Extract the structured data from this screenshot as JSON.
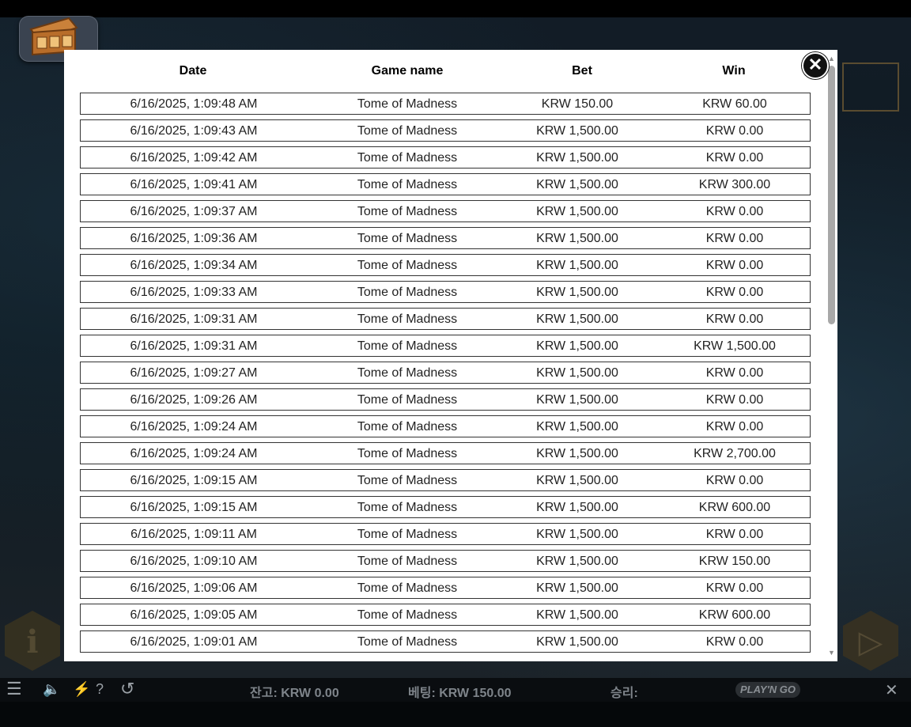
{
  "modal": {
    "headers": {
      "date": "Date",
      "game": "Game name",
      "bet": "Bet",
      "win": "Win"
    },
    "rows": [
      {
        "date": "6/16/2025, 1:09:48 AM",
        "game": "Tome of Madness",
        "bet": "KRW 150.00",
        "win": "KRW 60.00"
      },
      {
        "date": "6/16/2025, 1:09:43 AM",
        "game": "Tome of Madness",
        "bet": "KRW 1,500.00",
        "win": "KRW 0.00"
      },
      {
        "date": "6/16/2025, 1:09:42 AM",
        "game": "Tome of Madness",
        "bet": "KRW 1,500.00",
        "win": "KRW 0.00"
      },
      {
        "date": "6/16/2025, 1:09:41 AM",
        "game": "Tome of Madness",
        "bet": "KRW 1,500.00",
        "win": "KRW 300.00"
      },
      {
        "date": "6/16/2025, 1:09:37 AM",
        "game": "Tome of Madness",
        "bet": "KRW 1,500.00",
        "win": "KRW 0.00"
      },
      {
        "date": "6/16/2025, 1:09:36 AM",
        "game": "Tome of Madness",
        "bet": "KRW 1,500.00",
        "win": "KRW 0.00"
      },
      {
        "date": "6/16/2025, 1:09:34 AM",
        "game": "Tome of Madness",
        "bet": "KRW 1,500.00",
        "win": "KRW 0.00"
      },
      {
        "date": "6/16/2025, 1:09:33 AM",
        "game": "Tome of Madness",
        "bet": "KRW 1,500.00",
        "win": "KRW 0.00"
      },
      {
        "date": "6/16/2025, 1:09:31 AM",
        "game": "Tome of Madness",
        "bet": "KRW 1,500.00",
        "win": "KRW 0.00"
      },
      {
        "date": "6/16/2025, 1:09:31 AM",
        "game": "Tome of Madness",
        "bet": "KRW 1,500.00",
        "win": "KRW 1,500.00"
      },
      {
        "date": "6/16/2025, 1:09:27 AM",
        "game": "Tome of Madness",
        "bet": "KRW 1,500.00",
        "win": "KRW 0.00"
      },
      {
        "date": "6/16/2025, 1:09:26 AM",
        "game": "Tome of Madness",
        "bet": "KRW 1,500.00",
        "win": "KRW 0.00"
      },
      {
        "date": "6/16/2025, 1:09:24 AM",
        "game": "Tome of Madness",
        "bet": "KRW 1,500.00",
        "win": "KRW 0.00"
      },
      {
        "date": "6/16/2025, 1:09:24 AM",
        "game": "Tome of Madness",
        "bet": "KRW 1,500.00",
        "win": "KRW 2,700.00"
      },
      {
        "date": "6/16/2025, 1:09:15 AM",
        "game": "Tome of Madness",
        "bet": "KRW 1,500.00",
        "win": "KRW 0.00"
      },
      {
        "date": "6/16/2025, 1:09:15 AM",
        "game": "Tome of Madness",
        "bet": "KRW 1,500.00",
        "win": "KRW 600.00"
      },
      {
        "date": "6/16/2025, 1:09:11 AM",
        "game": "Tome of Madness",
        "bet": "KRW 1,500.00",
        "win": "KRW 0.00"
      },
      {
        "date": "6/16/2025, 1:09:10 AM",
        "game": "Tome of Madness",
        "bet": "KRW 1,500.00",
        "win": "KRW 150.00"
      },
      {
        "date": "6/16/2025, 1:09:06 AM",
        "game": "Tome of Madness",
        "bet": "KRW 1,500.00",
        "win": "KRW 0.00"
      },
      {
        "date": "6/16/2025, 1:09:05 AM",
        "game": "Tome of Madness",
        "bet": "KRW 1,500.00",
        "win": "KRW 600.00"
      },
      {
        "date": "6/16/2025, 1:09:01 AM",
        "game": "Tome of Madness",
        "bet": "KRW 1,500.00",
        "win": "KRW 0.00"
      }
    ],
    "close_icon": "close-icon",
    "close_glyph": "✕"
  },
  "bottom_bar": {
    "menu_glyph": "☰",
    "sound_glyph": "🔈",
    "turbo_glyph": "⚡",
    "help_glyph": "?",
    "history_glyph": "↺",
    "balance": "잔고: KRW 0.00",
    "bet": "베팅: KRW 150.00",
    "win": "승리:",
    "close_glyph": "✕"
  },
  "game": {
    "info_glyph": "i",
    "play_glyph": "▷"
  },
  "colors": {
    "modal_bg": "#ffffff",
    "row_border": "#333333",
    "bar_bg": "#0a0d10"
  }
}
